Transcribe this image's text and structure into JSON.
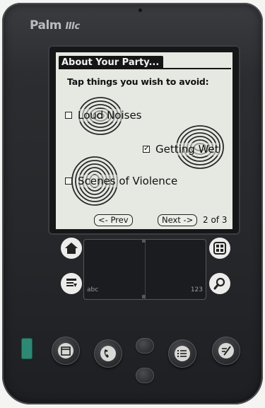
{
  "device": {
    "brand": "Palm",
    "model": "IIIc"
  },
  "app": {
    "title": "About Your Party...",
    "prompt": "Tap things you wish to avoid:",
    "options": [
      {
        "label": "Loud Noises",
        "checked": false
      },
      {
        "label": "Getting Wet",
        "checked": true
      },
      {
        "label": "Scenes of Violence",
        "checked": false
      }
    ],
    "prev_label": "<- Prev",
    "next_label": "Next ->",
    "page_indicator": "2 of 3"
  },
  "silkscreen": {
    "left_icons": [
      "home-icon",
      "menu-icon"
    ],
    "right_icons": [
      "calculator-icon",
      "find-icon"
    ],
    "graffiti_left_label": "abc",
    "graffiti_right_label": "123"
  },
  "hardware_buttons": [
    "date-book-button",
    "address-button",
    "scroll-up-button",
    "scroll-down-button",
    "todo-button",
    "memo-button"
  ],
  "colors": {
    "lcd": "#e6e8e2",
    "body": "#2b2d30",
    "power_button": "#2a8a73"
  }
}
